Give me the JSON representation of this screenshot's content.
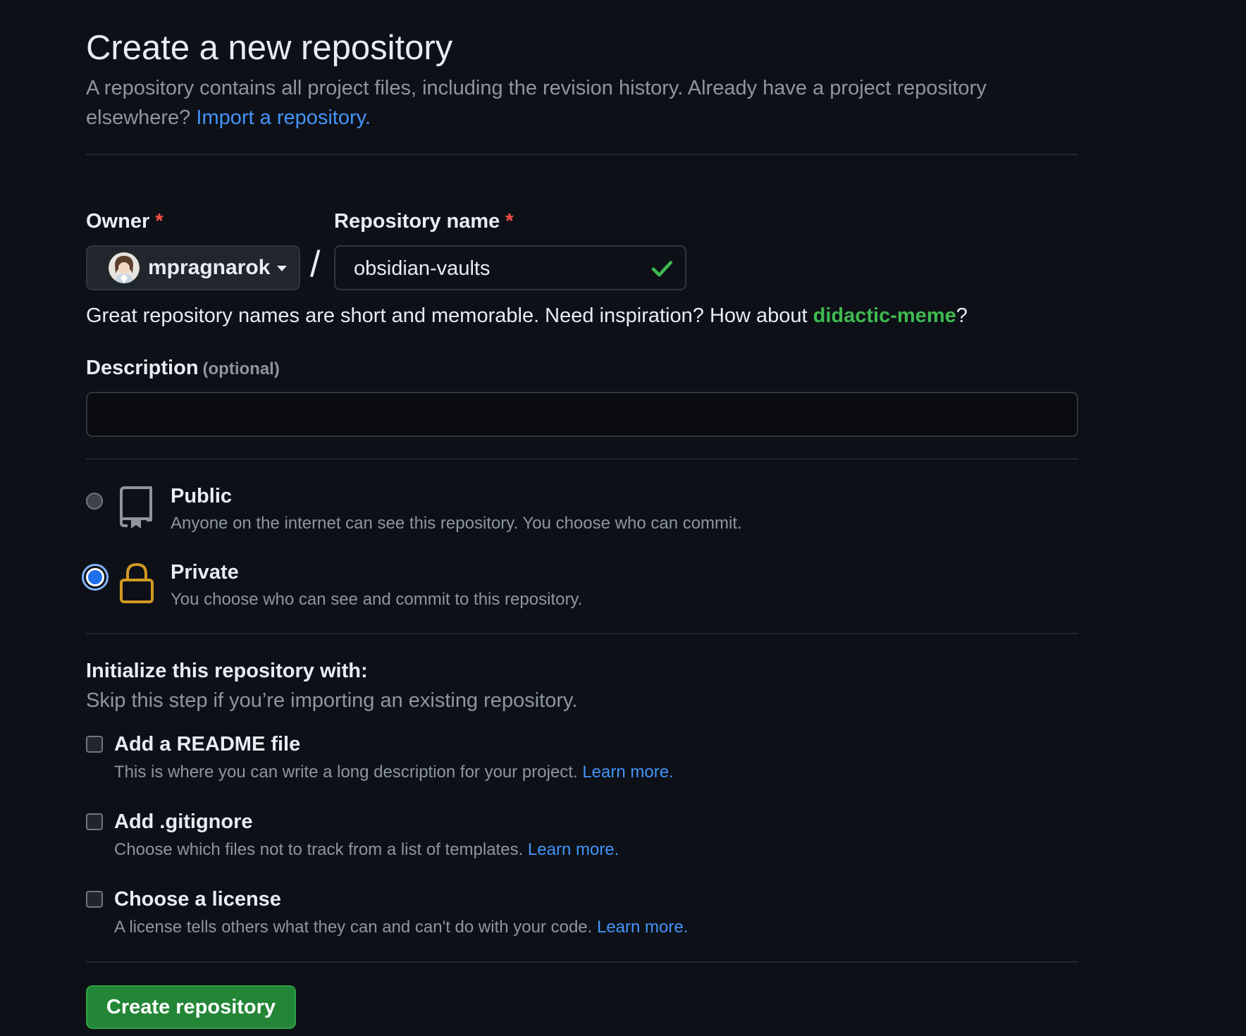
{
  "header": {
    "title": "Create a new repository",
    "intro_text": "A repository contains all project files, including the revision history. Already have a project repository elsewhere?",
    "import_link": "Import a repository."
  },
  "owner": {
    "label": "Owner",
    "required_mark": "*",
    "value": "mpragnarok",
    "icon": "chevron-down-icon"
  },
  "separator": "/",
  "repo_name": {
    "label": "Repository name",
    "required_mark": "*",
    "value": "obsidian-vaults",
    "status_icon": "check-icon",
    "status_color": "#3fb950"
  },
  "name_hint": {
    "text": "Great repository names are short and memorable. Need inspiration? How about",
    "suggestion": "didactic-meme",
    "suffix": "?"
  },
  "description": {
    "label": "Description",
    "optional": "(optional)",
    "value": "",
    "placeholder": ""
  },
  "visibility": {
    "options": [
      {
        "label": "Public",
        "description": "Anyone on the internet can see this repository. You choose who can commit.",
        "icon": "repo-icon",
        "selected": false
      },
      {
        "label": "Private",
        "description": "You choose who can see and commit to this repository.",
        "icon": "lock-icon",
        "selected": true
      }
    ]
  },
  "initialize": {
    "title": "Initialize this repository with:",
    "subtitle": "Skip this step if you’re importing an existing repository.",
    "options": [
      {
        "label": "Add a README file",
        "description": "This is where you can write a long description for your project.",
        "link": "Learn more.",
        "checked": false
      },
      {
        "label": "Add .gitignore",
        "description": "Choose which files not to track from a list of templates.",
        "link": "Learn more.",
        "checked": false
      },
      {
        "label": "Choose a license",
        "description": "A license tells others what they can and can't do with your code.",
        "link": "Learn more.",
        "checked": false
      }
    ]
  },
  "submit": {
    "label": "Create repository"
  },
  "colors": {
    "background": "#0d1117",
    "accent_link": "#4493f8",
    "success": "#3fb950",
    "primary_button": "#238636",
    "lock_icon": "#d29922",
    "required": "#f85149"
  }
}
